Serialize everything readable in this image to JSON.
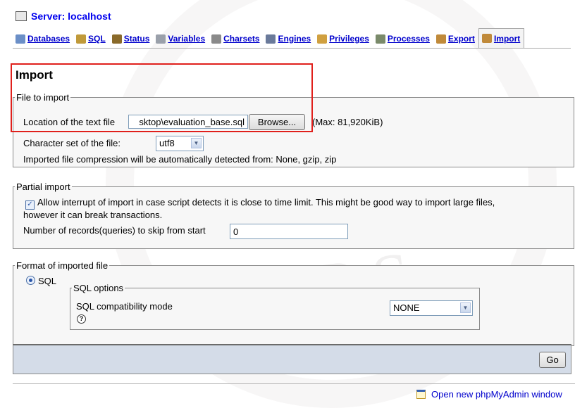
{
  "server": {
    "label": "Server: localhost",
    "icon": "server-icon"
  },
  "tabs": [
    {
      "label": "Databases",
      "icon": "databases-icon",
      "color": "#6b8fc7"
    },
    {
      "label": "SQL",
      "icon": "sql-icon",
      "color": "#c09a3a"
    },
    {
      "label": "Status",
      "icon": "status-icon",
      "color": "#8a6a2a"
    },
    {
      "label": "Variables",
      "icon": "variables-icon",
      "color": "#9aa0aa"
    },
    {
      "label": "Charsets",
      "icon": "charsets-icon",
      "color": "#8a8a8a"
    },
    {
      "label": "Engines",
      "icon": "engines-icon",
      "color": "#6a7a9a"
    },
    {
      "label": "Privileges",
      "icon": "privileges-icon",
      "color": "#d0a040"
    },
    {
      "label": "Processes",
      "icon": "processes-icon",
      "color": "#7a8a6a"
    },
    {
      "label": "Export",
      "icon": "export-icon",
      "color": "#c08a3a"
    },
    {
      "label": "Import",
      "icon": "import-icon",
      "color": "#c08a3a"
    }
  ],
  "import": {
    "title": "Import",
    "file_section": {
      "legend": "File to import",
      "location_label": "Location of the text file",
      "file_value": "sktop\\evaluation_base.sql",
      "browse_label": "Browse...",
      "max_text": "(Max: 81,920KiB)",
      "charset_label": "Character set of the file:",
      "charset_value": "utf8",
      "compression_text": "Imported file compression will be automatically detected from: None, gzip, zip"
    },
    "partial_section": {
      "legend": "Partial import",
      "allow_interrupt_line1": "Allow interrupt of import in case script detects it is close to time limit. This might be good way to import large files,",
      "allow_interrupt_line2": "however it can break transactions.",
      "allow_interrupt_checked": true,
      "skip_label": "Number of records(queries) to skip from start",
      "skip_value": "0"
    },
    "format_section": {
      "legend": "Format of imported file",
      "format_option": "SQL",
      "sql_options_legend": "SQL options",
      "compat_label": "SQL compatibility mode",
      "compat_value": "NONE"
    },
    "go_label": "Go"
  },
  "footer": {
    "open_new_window": "Open new phpMyAdmin window"
  },
  "colors": {
    "link": "#0000cc",
    "highlight_box": "#e0201c",
    "go_bar": "#d4dce8"
  }
}
